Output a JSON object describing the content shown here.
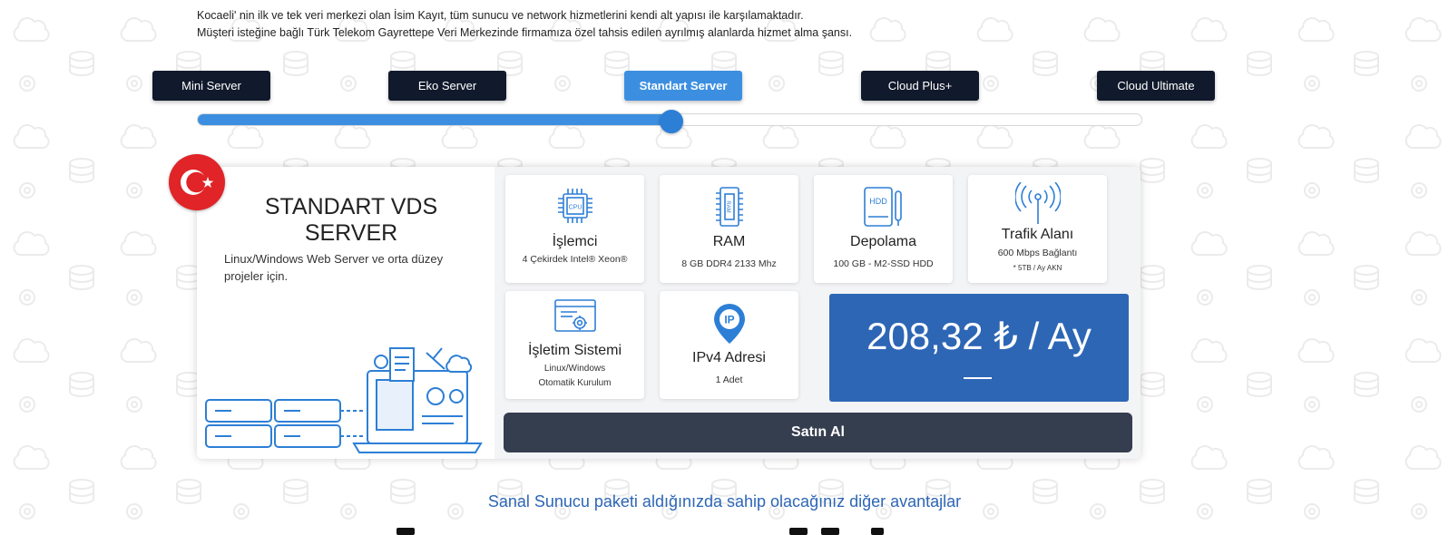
{
  "intro": {
    "line1": "Kocaeli' nin ilk ve tek veri merkezi olan İsim Kayıt, tüm sunucu ve network hizmetlerini kendi alt yapısı ile karşılamaktadır.",
    "line2": "Müşteri isteğine bağlı Türk Telekom Gayrettepe Veri Merkezinde firmamıza özel tahsis edilen ayrılmış alanlarda hizmet alma şansı."
  },
  "plans": [
    {
      "label": "Mini Server"
    },
    {
      "label": "Eko Server"
    },
    {
      "label": "Standart Server",
      "active": true
    },
    {
      "label": "Cloud Plus+"
    },
    {
      "label": "Cloud Ultimate"
    }
  ],
  "slider": {
    "value_percent": 50
  },
  "card": {
    "title": "STANDART VDS SERVER",
    "description": "Linux/Windows Web Server ve orta düzey projeler için.",
    "features": {
      "cpu": {
        "name": "İşlemci",
        "sub": "4 Çekirdek Intel® Xeon®",
        "icon_text": "CPU"
      },
      "ram": {
        "name": "RAM",
        "sub": "8 GB DDR4 2133 Mhz",
        "icon_text": "RAM"
      },
      "storage": {
        "name": "Depolama",
        "sub": "100 GB - M2-SSD HDD",
        "icon_text": "HDD"
      },
      "traffic": {
        "name": "Trafik Alanı",
        "sub": "600 Mbps Bağlantı",
        "sub2": "* 5TB / Ay AKN"
      },
      "os": {
        "name": "İşletim Sistemi",
        "sub1": "Linux/Windows",
        "sub2": "Otomatik Kurulum"
      },
      "ip": {
        "name": "IPv4 Adresi",
        "sub": "1 Adet",
        "icon_text": "IP"
      }
    },
    "price": "208,32 ₺ / Ay",
    "buy_label": "Satın Al"
  },
  "advantages_heading": "Sanal Sunucu paketi aldığınızda sahip olacağınız diğer avantajlar",
  "colors": {
    "accent": "#3c8fe0",
    "dark_button": "#111a2c",
    "price_bg": "#2d66b5",
    "buy_bg": "#353e4f",
    "flag_red": "#e02427"
  }
}
